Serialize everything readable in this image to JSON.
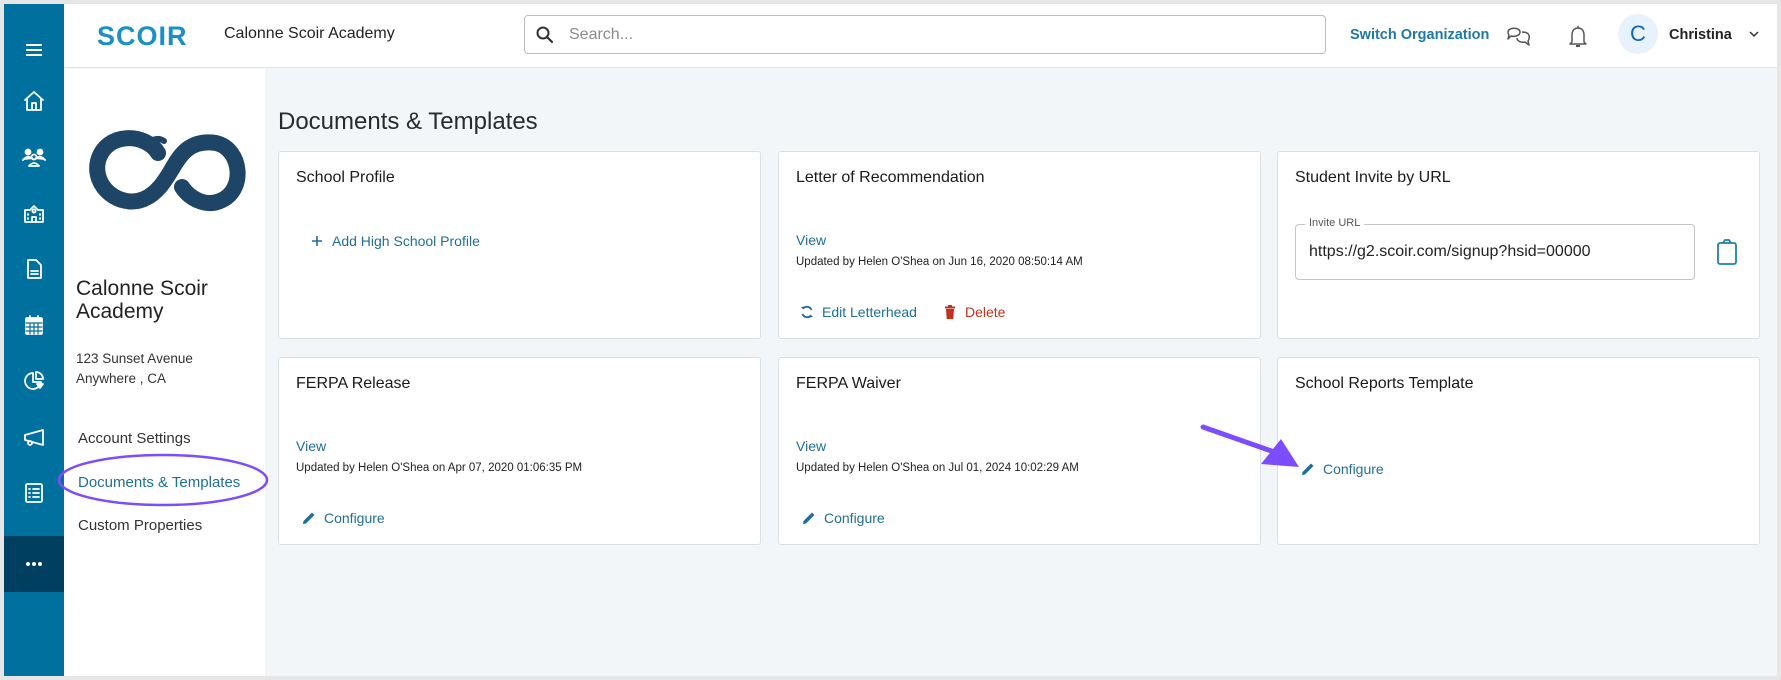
{
  "header": {
    "brand": "SCOIR",
    "org_name": "Calonne Scoir Academy",
    "search_placeholder": "Search...",
    "switch_org": "Switch Organization",
    "user_initial": "C",
    "user_name": "Christina"
  },
  "rail": {
    "items": [
      "menu-icon",
      "home-icon",
      "students-icon",
      "school-icon",
      "document-icon",
      "calendar-icon",
      "analytics-icon",
      "megaphone-icon",
      "checklist-icon",
      "more-icon"
    ],
    "active": "more-icon"
  },
  "subnav": {
    "school_name": "Calonne Scoir Academy",
    "address_line1": "123 Sunset Avenue",
    "address_line2": "Anywhere , CA",
    "links": [
      {
        "label": "Account Settings",
        "active": false
      },
      {
        "label": "Documents & Templates",
        "active": true
      },
      {
        "label": "Custom Properties",
        "active": false
      }
    ]
  },
  "main": {
    "title": "Documents & Templates",
    "cards": {
      "school_profile": {
        "title": "School Profile",
        "add_label": "Add High School Profile"
      },
      "letter_of_recommendation": {
        "title": "Letter of Recommendation",
        "view_label": "View",
        "updated": "Updated by Helen O'Shea on Jun 16, 2020 08:50:14 AM",
        "edit_label": "Edit Letterhead",
        "delete_label": "Delete"
      },
      "student_invite": {
        "title": "Student Invite by URL",
        "field_label": "Invite URL",
        "field_value": "https://g2.scoir.com/signup?hsid=00000"
      },
      "ferpa_release": {
        "title": "FERPA Release",
        "view_label": "View",
        "updated": "Updated by Helen O'Shea on Apr 07, 2020 01:06:35 PM",
        "configure_label": "Configure"
      },
      "ferpa_waiver": {
        "title": "FERPA Waiver",
        "view_label": "View",
        "updated": "Updated by Helen O'Shea on Jul 01, 2024 10:02:29 AM",
        "configure_label": "Configure"
      },
      "school_reports": {
        "title": "School Reports Template",
        "configure_label": "Configure"
      }
    }
  },
  "colors": {
    "brand": "#1b8fc7",
    "rail": "#00719e",
    "rail_active": "#003f5f",
    "link": "#1f6f97",
    "danger": "#c0321f",
    "annotation": "#7c4dff"
  }
}
